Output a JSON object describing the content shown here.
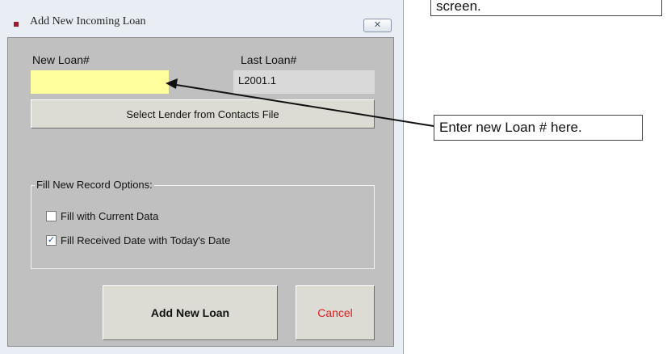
{
  "callouts": {
    "top_text": "screen.",
    "right_text": "Enter new Loan # here."
  },
  "window": {
    "title": "Add New Incoming Loan",
    "close_glyph": "✕"
  },
  "form": {
    "new_loan_label": "New Loan#",
    "new_loan_value": "",
    "last_loan_label": "Last Loan#",
    "last_loan_value": "L2001.1",
    "select_lender_label": "Select Lender from Contacts File",
    "options_legend": "Fill New Record Options:",
    "fill_current_label": "Fill with Current Data",
    "fill_current_checked": false,
    "fill_received_label": "Fill Received Date with Today's Date",
    "fill_received_checked": true,
    "add_button_label": "Add New Loan",
    "cancel_button_label": "Cancel"
  },
  "colors": {
    "accent_icon": "#9b1b30",
    "input_bg": "#ffff9e",
    "cancel_text": "#e01b1b"
  }
}
